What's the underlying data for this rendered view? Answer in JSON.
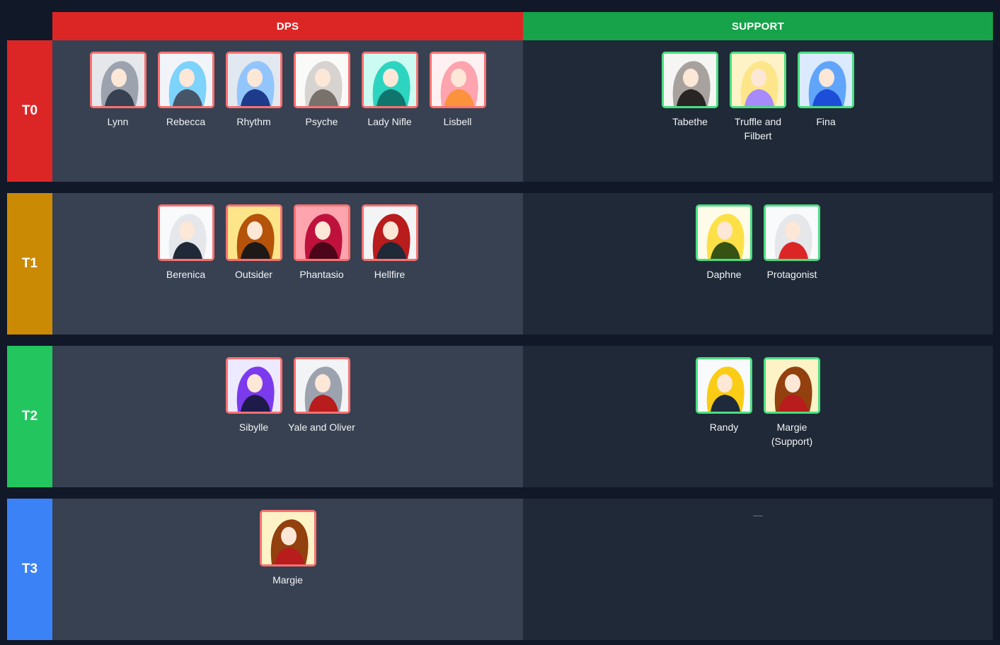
{
  "columns": [
    {
      "label": "DPS",
      "color": "#dc2626"
    },
    {
      "label": "SUPPORT",
      "color": "#16a34a"
    }
  ],
  "tiers": [
    {
      "label": "T0",
      "color": "#dc2626",
      "dps": [
        {
          "name": "Lynn",
          "palette": [
            "#9ca3af",
            "#374151",
            "#e5e7eb"
          ]
        },
        {
          "name": "Rebecca",
          "palette": [
            "#7dd3fc",
            "#475569",
            "#f1f5f9"
          ]
        },
        {
          "name": "Rhythm",
          "palette": [
            "#93c5fd",
            "#1e3a8a",
            "#e2e8f0"
          ]
        },
        {
          "name": "Psyche",
          "palette": [
            "#d6d3d1",
            "#78716c",
            "#fafaf9"
          ]
        },
        {
          "name": "Lady Nifle",
          "palette": [
            "#2dd4bf",
            "#0f766e",
            "#ccfbf1"
          ]
        },
        {
          "name": "Lisbell",
          "palette": [
            "#fda4af",
            "#fb923c",
            "#fff1f2"
          ]
        }
      ],
      "support": [
        {
          "name": "Tabethe",
          "palette": [
            "#a8a29e",
            "#292524",
            "#f5f5f4"
          ]
        },
        {
          "name": "Truffle and Filbert",
          "palette": [
            "#fde68a",
            "#a78bfa",
            "#fef3c7"
          ]
        },
        {
          "name": "Fina",
          "palette": [
            "#60a5fa",
            "#1d4ed8",
            "#dbeafe"
          ]
        }
      ]
    },
    {
      "label": "T1",
      "color": "#ca8a04",
      "dps": [
        {
          "name": "Berenica",
          "palette": [
            "#e5e7eb",
            "#1f2937",
            "#f9fafb"
          ]
        },
        {
          "name": "Outsider",
          "palette": [
            "#b45309",
            "#1c1917",
            "#fde68a"
          ]
        },
        {
          "name": "Phantasio",
          "palette": [
            "#be123c",
            "#4c0519",
            "#fda4af"
          ]
        },
        {
          "name": "Hellfire",
          "palette": [
            "#b91c1c",
            "#1f2937",
            "#f3f4f6"
          ]
        }
      ],
      "support": [
        {
          "name": "Daphne",
          "palette": [
            "#fde047",
            "#365314",
            "#fefce8"
          ]
        },
        {
          "name": "Protagonist",
          "palette": [
            "#e5e7eb",
            "#dc2626",
            "#f9fafb"
          ]
        }
      ]
    },
    {
      "label": "T2",
      "color": "#22c55e",
      "dps": [
        {
          "name": "Sibylle",
          "palette": [
            "#7c3aed",
            "#1e1b4b",
            "#ede9fe"
          ]
        },
        {
          "name": "Yale and Oliver",
          "palette": [
            "#9ca3af",
            "#b91c1c",
            "#f3f4f6"
          ]
        }
      ],
      "support": [
        {
          "name": "Randy",
          "palette": [
            "#facc15",
            "#1e293b",
            "#f8fafc"
          ]
        },
        {
          "name": "Margie (Support)",
          "palette": [
            "#92400e",
            "#b91c1c",
            "#fef3c7"
          ]
        }
      ]
    },
    {
      "label": "T3",
      "color": "#3b82f6",
      "dps": [
        {
          "name": "Margie",
          "palette": [
            "#92400e",
            "#b91c1c",
            "#fef3c7"
          ]
        }
      ],
      "support": []
    }
  ]
}
